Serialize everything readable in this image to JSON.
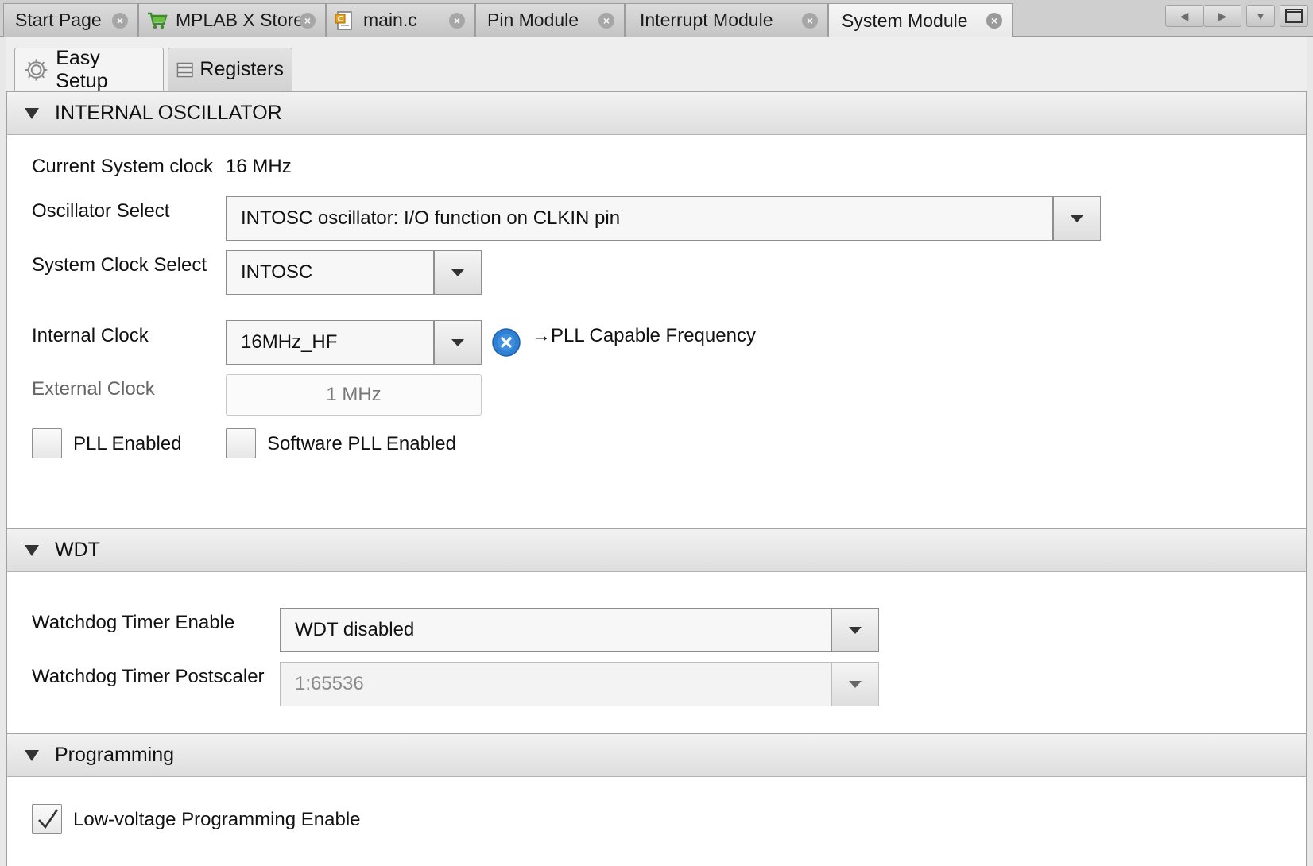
{
  "editor_tabs": [
    {
      "label": "Start Page",
      "icon": "none"
    },
    {
      "label": "MPLAB X Store",
      "icon": "cart-icon"
    },
    {
      "label": "main.c",
      "icon": "c-file-icon"
    },
    {
      "label": "Pin Module",
      "icon": "none"
    },
    {
      "label": "Interrupt Module",
      "icon": "none"
    },
    {
      "label": "System Module",
      "icon": "none",
      "active": true
    }
  ],
  "subtabs": {
    "easy_setup": "Easy Setup",
    "registers": "Registers"
  },
  "sections": {
    "internal_oscillator": {
      "title": "INTERNAL OSCILLATOR",
      "current_clock_label": "Current System clock",
      "current_clock_value": "16 MHz",
      "oscillator_select_label": "Oscillator Select",
      "oscillator_select_value": "INTOSC oscillator: I/O function on CLKIN pin",
      "system_clock_select_label": "System Clock Select",
      "system_clock_select_value": "INTOSC",
      "internal_clock_label": "Internal Clock",
      "internal_clock_value": "16MHz_HF",
      "pll_capable_text": "→PLL Capable Frequency",
      "external_clock_label": "External Clock",
      "external_clock_value": "1 MHz",
      "pll_enabled_label": "PLL Enabled",
      "pll_enabled_checked": false,
      "software_pll_label": "Software PLL Enabled",
      "software_pll_checked": false
    },
    "wdt": {
      "title": "WDT",
      "timer_enable_label": "Watchdog Timer Enable",
      "timer_enable_value": "WDT disabled",
      "postscaler_label": "Watchdog Timer Postscaler",
      "postscaler_value": "1:65536"
    },
    "programming": {
      "title": "Programming",
      "lvp_label": "Low-voltage Programming Enable",
      "lvp_checked": true
    }
  },
  "colors": {
    "info_icon_blue": "#2f7fd3"
  }
}
